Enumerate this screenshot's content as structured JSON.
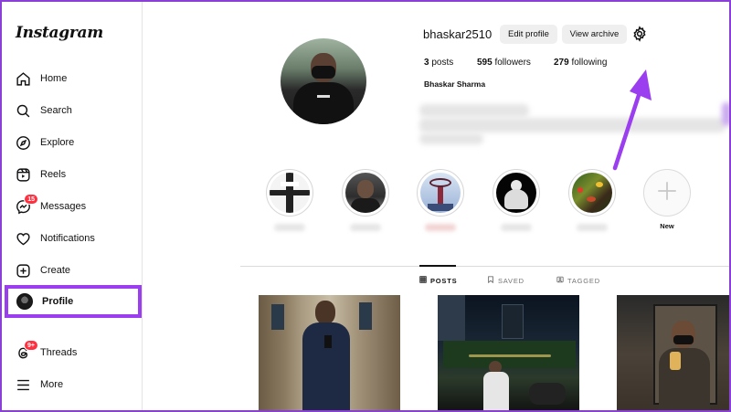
{
  "app": {
    "logo_text": "Instagram"
  },
  "sidebar": {
    "items": [
      {
        "label": "Home",
        "icon": "home-icon"
      },
      {
        "label": "Search",
        "icon": "search-icon"
      },
      {
        "label": "Explore",
        "icon": "compass-icon"
      },
      {
        "label": "Reels",
        "icon": "reels-icon"
      },
      {
        "label": "Messages",
        "icon": "messenger-icon",
        "badge": "15"
      },
      {
        "label": "Notifications",
        "icon": "heart-icon"
      },
      {
        "label": "Create",
        "icon": "plus-square-icon"
      },
      {
        "label": "Profile",
        "icon": "avatar",
        "active": true
      },
      {
        "label": "Threads",
        "icon": "threads-icon",
        "badge": "9+"
      },
      {
        "label": "More",
        "icon": "menu-icon"
      }
    ]
  },
  "profile": {
    "username": "bhaskar2510",
    "edit_label": "Edit profile",
    "archive_label": "View archive",
    "posts_count": "3",
    "posts_label": "posts",
    "followers_count": "595",
    "followers_label": "followers",
    "following_count": "279",
    "following_label": "following",
    "full_name": "Bhaskar Sharma"
  },
  "highlights": {
    "new_label": "New"
  },
  "tabs": [
    {
      "label": "POSTS",
      "icon": "grid-icon",
      "active": true
    },
    {
      "label": "SAVED",
      "icon": "bookmark-icon"
    },
    {
      "label": "TAGGED",
      "icon": "tag-icon"
    }
  ],
  "colors": {
    "annotation_purple": "#9b3ef0",
    "badge_red": "#ff3040",
    "button_gray": "#efefef"
  }
}
